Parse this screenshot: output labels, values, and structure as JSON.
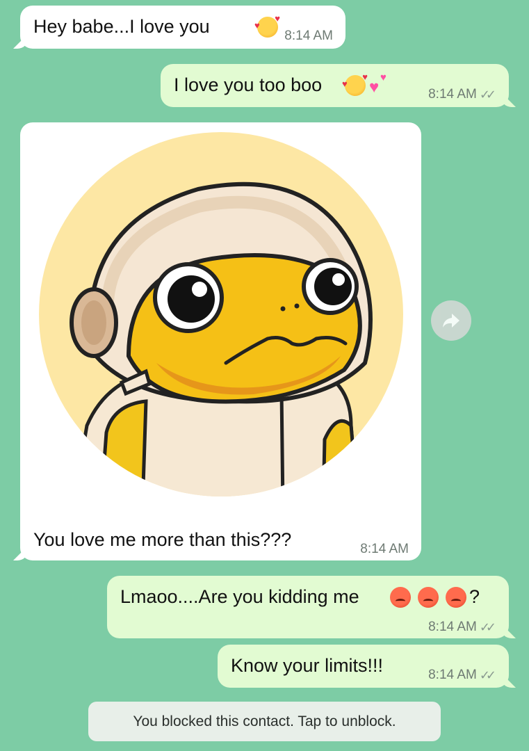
{
  "messages": {
    "m1": {
      "text": "Hey babe...I love you",
      "time": "8:14 AM"
    },
    "m2": {
      "text": "I love you too boo",
      "time": "8:14 AM"
    },
    "m3": {
      "caption": "You love me more than this???",
      "time": "8:14 AM",
      "image_icon": "astronaut-frog-sticker"
    },
    "m4": {
      "text": "Lmaoo....Are you kidding me",
      "suffix": "?",
      "time": "8:14 AM"
    },
    "m5": {
      "text": "Know your limits!!!",
      "time": "8:14 AM"
    }
  },
  "icons": {
    "read_receipt": "double-check-icon",
    "forward": "forward-icon",
    "emoji_love": "smiling-face-with-hearts-emoji",
    "emoji_angry": "angry-face-emoji",
    "emoji_hearts": "two-hearts-emoji"
  },
  "system_notice": "You blocked this contact. Tap to unblock.",
  "colors": {
    "chat_background": "#7dcca5",
    "incoming_bubble": "#ffffff",
    "outgoing_bubble": "#e2fbd2",
    "sticker_circle": "#fde7a4"
  }
}
